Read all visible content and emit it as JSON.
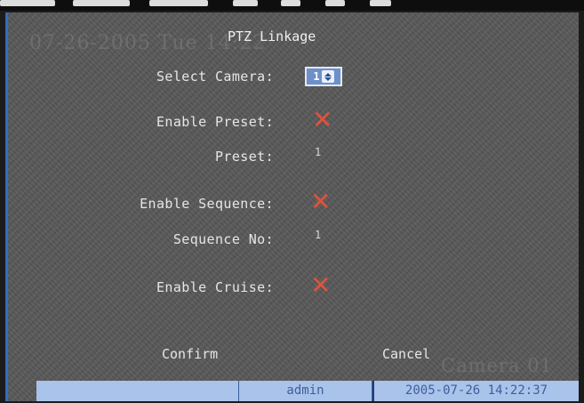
{
  "osd": {
    "datetime": "07-26-2005 Tue 14:22",
    "camera": "Camera 01"
  },
  "dialog": {
    "title": "PTZ Linkage",
    "select_camera_label": "Select Camera:",
    "select_camera_value": "1",
    "enable_preset_label": "Enable Preset:",
    "enable_preset_checked": false,
    "preset_label": "Preset:",
    "preset_value": "1",
    "enable_sequence_label": "Enable Sequence:",
    "enable_sequence_checked": false,
    "sequence_no_label": "Sequence No:",
    "sequence_no_value": "1",
    "enable_cruise_label": "Enable Cruise:",
    "enable_cruise_checked": false,
    "unchecked_glyph": "✕",
    "confirm_label": "Confirm",
    "cancel_label": "Cancel"
  },
  "status_bar": {
    "segment1": "",
    "user": "admin",
    "datetime": "2005-07-26 14:22:37"
  },
  "colors": {
    "panel": "#585858",
    "accent_blue": "#2c6ec4",
    "unchecked_red": "#e0523c",
    "status_bar": "#a9c3ea",
    "status_text": "#3f5f9a"
  }
}
